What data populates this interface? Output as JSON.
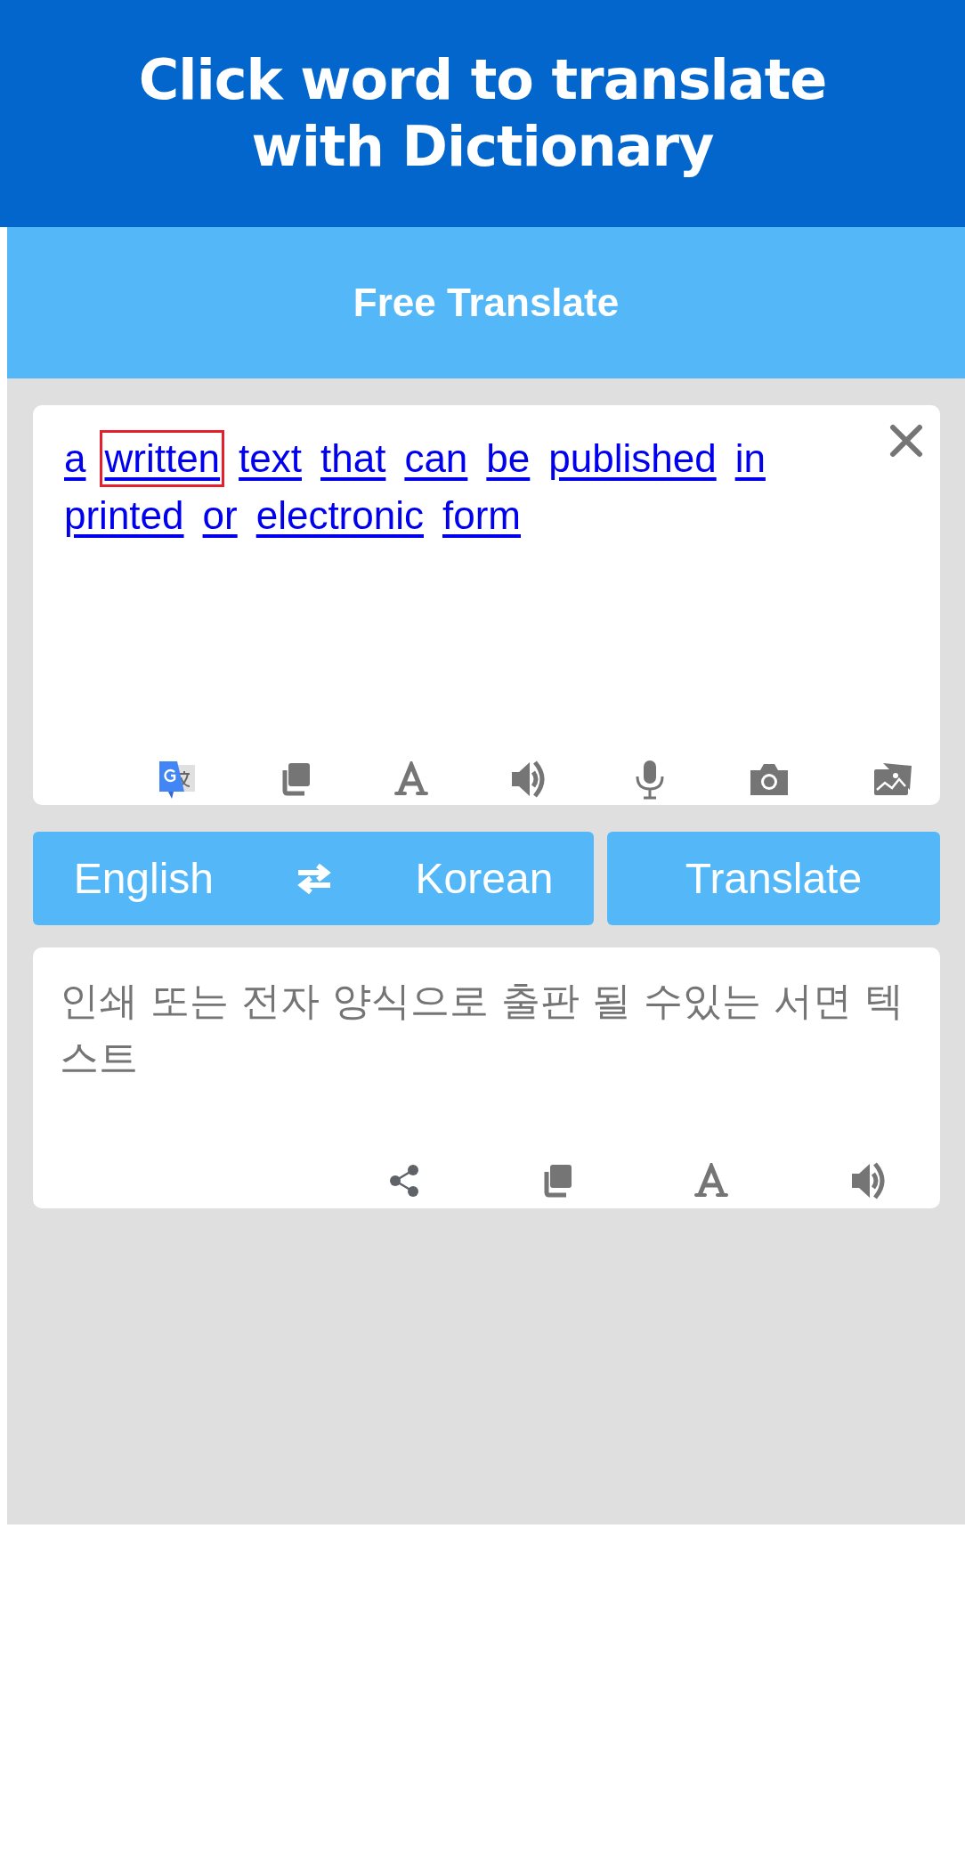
{
  "banner": {
    "title": "Click word to translate with Dictionary"
  },
  "header": {
    "title": "Free Translate"
  },
  "source": {
    "words": [
      {
        "text": "a",
        "selected": false
      },
      {
        "text": "written",
        "selected": true
      },
      {
        "text": "text",
        "selected": false
      },
      {
        "text": "that",
        "selected": false
      },
      {
        "text": "can",
        "selected": false
      },
      {
        "text": "be",
        "selected": false
      },
      {
        "text": "published",
        "selected": false
      },
      {
        "text": "in",
        "selected": false
      },
      {
        "text": "printed",
        "selected": false
      },
      {
        "text": "or",
        "selected": false
      },
      {
        "text": "electronic",
        "selected": false
      },
      {
        "text": "form",
        "selected": false
      }
    ]
  },
  "languages": {
    "from": "English",
    "to": "Korean"
  },
  "translate_button": "Translate",
  "result": {
    "text": "인쇄 또는 전자 양식으로 출판 될 수있는 서면 텍스트"
  }
}
